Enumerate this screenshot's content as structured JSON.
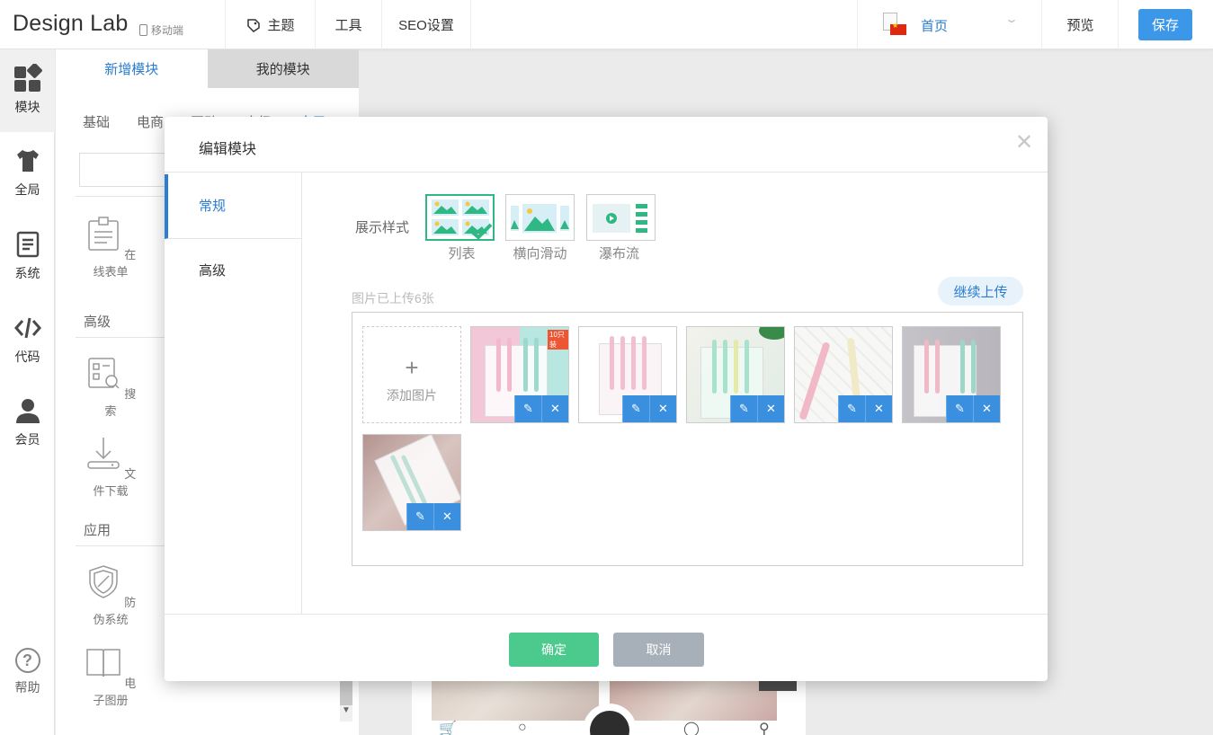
{
  "header": {
    "logo": "Design Lab",
    "device": "移动端",
    "nav": [
      {
        "label": "主题",
        "icon": "theme-icon"
      },
      {
        "label": "工具"
      },
      {
        "label": "SEO设置"
      }
    ],
    "page_selector": {
      "value": "首页"
    },
    "preview_label": "预览",
    "save_label": "保存"
  },
  "rail": {
    "items": [
      {
        "label": "模块",
        "icon": "modules-icon"
      },
      {
        "label": "全局",
        "icon": "shirt-icon"
      },
      {
        "label": "系统",
        "icon": "document-icon"
      },
      {
        "label": "代码",
        "icon": "code-icon"
      },
      {
        "label": "会员",
        "icon": "user-icon"
      }
    ],
    "help_label": "帮助"
  },
  "module_panel": {
    "tabs": [
      "新增模块",
      "我的模块"
    ],
    "categories": [
      "基础",
      "电商",
      "互动",
      "高级",
      "应用"
    ],
    "items_top": [
      {
        "label": "在线表单",
        "icon": "form-icon"
      }
    ],
    "section_advanced": "高级",
    "items_advanced": [
      {
        "label": "搜索",
        "icon": "search-doc-icon"
      },
      {
        "label": "文件下载",
        "icon": "download-icon"
      }
    ],
    "section_apps": "应用",
    "items_apps": [
      {
        "label": "防伪系统",
        "icon": "shield-icon"
      },
      {
        "label": "电子图册",
        "icon": "book-icon"
      }
    ]
  },
  "modal": {
    "title": "编辑模块",
    "side_tabs": [
      "常规",
      "高级"
    ],
    "style_label": "展示样式",
    "styles": [
      {
        "label": "列表",
        "selected": true
      },
      {
        "label": "横向滑动",
        "selected": false
      },
      {
        "label": "瀑布流",
        "selected": false
      }
    ],
    "uploaded_text": "图片已上传6张",
    "upload_more": "继续上传",
    "add_image": "添加图片",
    "image_count": 6,
    "confirm": "确定",
    "cancel": "取消"
  },
  "colors": {
    "accent": "#2a7dd0",
    "save": "#3d97e8",
    "confirm": "#4cc98c",
    "cancel": "#a7b0b8",
    "selected_style": "#2fb784"
  }
}
